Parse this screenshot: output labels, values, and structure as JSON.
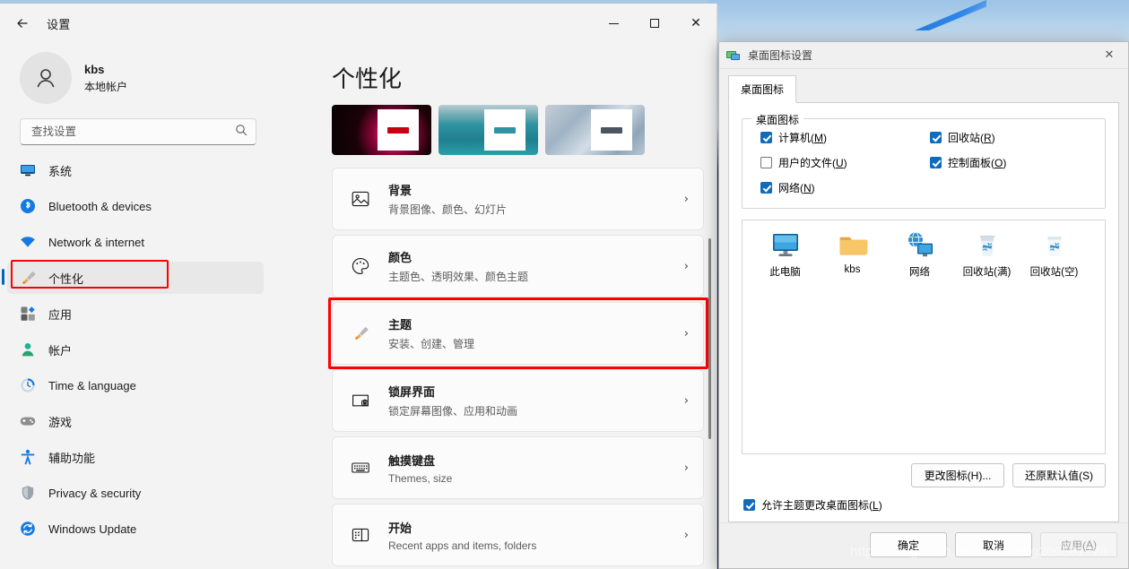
{
  "desktop": {
    "watermark": "https://blog.csdn.net/hanzheng260561728"
  },
  "settings_window": {
    "title": "设置",
    "back_icon": "back-arrow-icon",
    "controls": {
      "minimize": "minimize-icon",
      "maximize": "maximize-icon",
      "close": "close-icon"
    },
    "account": {
      "name": "kbs",
      "subtitle": "本地帐户",
      "avatar_icon": "person-avatar-icon"
    },
    "search": {
      "placeholder": "查找设置",
      "value": "",
      "icon": "search-icon"
    },
    "sidebar": {
      "items": [
        {
          "label": "系统",
          "icon": "monitor-icon",
          "selected": false
        },
        {
          "label": "Bluetooth & devices",
          "icon": "bluetooth-icon",
          "selected": false
        },
        {
          "label": "Network & internet",
          "icon": "wifi-icon",
          "selected": false
        },
        {
          "label": "个性化",
          "icon": "paintbrush-icon",
          "selected": true
        },
        {
          "label": "应用",
          "icon": "apps-icon",
          "selected": false
        },
        {
          "label": "帐户",
          "icon": "account-icon",
          "selected": false
        },
        {
          "label": "Time & language",
          "icon": "clock-icon",
          "selected": false
        },
        {
          "label": "游戏",
          "icon": "gamepad-icon",
          "selected": false
        },
        {
          "label": "辅助功能",
          "icon": "accessibility-icon",
          "selected": false
        },
        {
          "label": "Privacy & security",
          "icon": "shield-icon",
          "selected": false
        },
        {
          "label": "Windows Update",
          "icon": "update-icon",
          "selected": false
        }
      ]
    },
    "main": {
      "page_title": "个性化",
      "theme_thumbnails": [
        {
          "name": "theme-flower-dark",
          "bg": "#120207",
          "accent": "#c9000f"
        },
        {
          "name": "theme-beach-teal",
          "bg": "#2f8e96",
          "accent": "#2e94a4"
        },
        {
          "name": "theme-bloom-gray",
          "bg": "#aab7c2",
          "accent": "#4a5560"
        }
      ],
      "cards": [
        {
          "title": "背景",
          "subtitle": "背景图像、颜色、幻灯片",
          "icon": "image-icon",
          "highlight": false
        },
        {
          "title": "颜色",
          "subtitle": "主题色、透明效果、颜色主题",
          "icon": "palette-icon",
          "highlight": false
        },
        {
          "title": "主题",
          "subtitle": "安装、创建、管理",
          "icon": "paintbrush-icon",
          "highlight": true
        },
        {
          "title": "锁屏界面",
          "subtitle": "锁定屏幕图像、应用和动画",
          "icon": "lockscreen-icon",
          "highlight": false
        },
        {
          "title": "触摸键盘",
          "subtitle": "Themes, size",
          "icon": "keyboard-icon",
          "highlight": false
        },
        {
          "title": "开始",
          "subtitle": "Recent apps and items, folders",
          "icon": "start-icon",
          "highlight": false
        }
      ],
      "chevron": "›"
    }
  },
  "icon_dialog": {
    "title": "桌面图标设置",
    "title_icon": "desktop-icons-icon",
    "close_icon": "close-icon",
    "tab": "桌面图标",
    "group_legend": "桌面图标",
    "checkboxes": [
      {
        "label_pre": "计算机(",
        "key": "M",
        "label_post": ")",
        "checked": true,
        "name": "computer"
      },
      {
        "label_pre": "回收站(",
        "key": "R",
        "label_post": ")",
        "checked": true,
        "name": "recycle-bin"
      },
      {
        "label_pre": "用户的文件(",
        "key": "U",
        "label_post": ")",
        "checked": false,
        "name": "user-files"
      },
      {
        "label_pre": "控制面板(",
        "key": "O",
        "label_post": ")",
        "checked": true,
        "name": "control-panel"
      },
      {
        "label_pre": "网络(",
        "key": "N",
        "label_post": ")",
        "checked": true,
        "name": "network"
      }
    ],
    "preview_icons": [
      {
        "caption": "此电脑",
        "icon": "this-pc-icon"
      },
      {
        "caption": "kbs",
        "icon": "folder-icon"
      },
      {
        "caption": "网络",
        "icon": "network-icon"
      },
      {
        "caption": "回收站(满)",
        "icon": "recycle-bin-full-icon"
      },
      {
        "caption": "回收站(空)",
        "icon": "recycle-bin-empty-icon"
      }
    ],
    "change_icon_button": "更改图标(H)...",
    "restore_default_button": "还原默认值(S)",
    "allow_theme_change": {
      "label_pre": "允许主题更改桌面图标(",
      "key": "L",
      "label_post": ")",
      "checked": true
    },
    "footer_buttons": [
      {
        "label": "确定",
        "name": "ok",
        "disabled": false
      },
      {
        "label": "取消",
        "name": "cancel",
        "disabled": false
      },
      {
        "label_pre": "应用(",
        "key": "A",
        "label_post": ")",
        "name": "apply",
        "disabled": true
      }
    ]
  }
}
